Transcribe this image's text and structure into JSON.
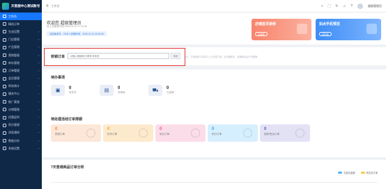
{
  "brand": {
    "name": "天客服中心测试账号"
  },
  "sidebar": {
    "items": [
      {
        "label": "工作台",
        "active": true
      },
      {
        "label": "精选订单"
      },
      {
        "label": "生成设置"
      },
      {
        "label": "门店管理"
      },
      {
        "label": "产品管理"
      },
      {
        "label": "营销管理"
      },
      {
        "label": "库存管理"
      },
      {
        "label": "订单管理"
      },
      {
        "label": "会员管理"
      },
      {
        "label": "财务统计"
      },
      {
        "label": "服务中心"
      },
      {
        "label": "推广渠道"
      },
      {
        "label": "分销管理"
      },
      {
        "label": "优惠返利"
      },
      {
        "label": "积分管理"
      },
      {
        "label": "消息通知"
      },
      {
        "label": "数据分析"
      },
      {
        "label": "系统设置"
      }
    ]
  },
  "topbar": {
    "breadcrumb": "工作台",
    "user_name": "超级管理员"
  },
  "welcome": {
    "title": "欢迎您 超级管理员",
    "subtitle": "您上次登录时间 2025-04-11 17:13:26",
    "meta": "当前版本号：2200.0  到期时间：2025-12-31 00:00:00"
  },
  "promos": [
    {
      "title": "店铺首页装修",
      "button": "去装修"
    },
    {
      "title": "如点手机预览",
      "button": "去扫码"
    }
  ],
  "search": {
    "label": "核销订单",
    "placeholder": "请输入核销码/订单号/手机号",
    "button": "核销",
    "hint": "提示：已核销的订单将计入已完成订单，请仔细核对，核销成功后不可撤销"
  },
  "todo": {
    "title": "待办事项",
    "items": [
      {
        "num": "0",
        "label": "待发货",
        "icon": "box-icon"
      },
      {
        "num": "0",
        "label": "待核销",
        "icon": "calendar-icon"
      },
      {
        "num": "0",
        "label": "已逾期",
        "icon": "truck-icon"
      }
    ]
  },
  "pending": {
    "title": "待处理活动订单排期",
    "cards": [
      {
        "num": "0",
        "label": "拼团订单",
        "color": "#fde7d8",
        "num_color": "#f0863a"
      },
      {
        "num": "0",
        "label": "秒杀订单",
        "color": "#fdeacd",
        "num_color": "#f5a623"
      },
      {
        "num": "0",
        "label": "砍价订单",
        "color": "#fbdde9",
        "num_color": "#e8538d"
      },
      {
        "num": "0",
        "label": "积分订单",
        "color": "#d6efff",
        "num_color": "#3aa0e8"
      },
      {
        "num": "0",
        "label": "退款/售后订单",
        "color": "#e3e2f5",
        "num_color": "#5a5dc6"
      }
    ]
  },
  "analysis": {
    "title": "7天普通商品订单分析",
    "legend": [
      {
        "label": "交易总金额",
        "color": "#4fb3f7"
      },
      {
        "label": "成交总订单",
        "color": "#f7c948"
      }
    ]
  }
}
